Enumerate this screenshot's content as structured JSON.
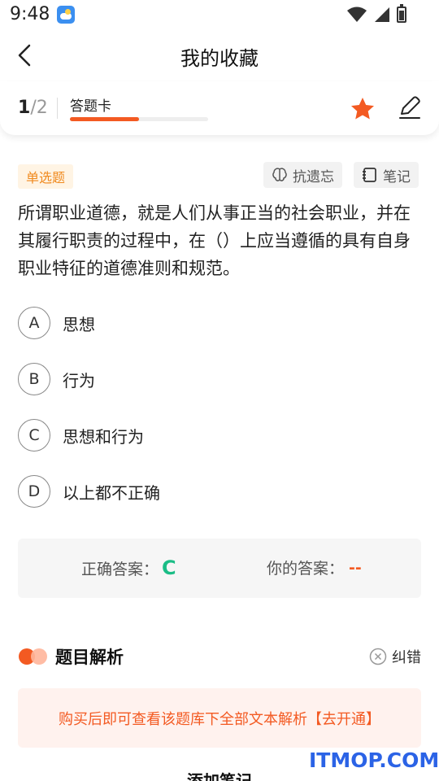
{
  "status": {
    "time": "9:48"
  },
  "header": {
    "title": "我的收藏"
  },
  "progress": {
    "current": "1",
    "total": "/2",
    "label": "答题卡",
    "fraction": 0.5
  },
  "question": {
    "type": "单选题",
    "anti_forget_label": "抗遗忘",
    "note_label": "笔记",
    "text": "所谓职业道德，就是人们从事正当的社会职业，并在其履行职责的过程中，在（）上应当遵循的具有自身职业特征的道德准则和规范。",
    "options": [
      {
        "letter": "A",
        "text": "思想"
      },
      {
        "letter": "B",
        "text": "行为"
      },
      {
        "letter": "C",
        "text": "思想和行为"
      },
      {
        "letter": "D",
        "text": "以上都不正确"
      }
    ]
  },
  "answer": {
    "correct_label": "正确答案：",
    "correct_value": "C",
    "yours_label": "你的答案：",
    "yours_value": "--"
  },
  "analysis": {
    "title": "题目解析",
    "report_label": "纠错",
    "purchase_text": "购买后即可查看该题库下全部文本解析【去开通】"
  },
  "footer": {
    "add_note": "添加笔记"
  },
  "watermark": {
    "logo": "ITMOP.COM"
  },
  "colors": {
    "accent": "#f35a22",
    "correct": "#1bbd86",
    "badge": "#f08a1f"
  }
}
